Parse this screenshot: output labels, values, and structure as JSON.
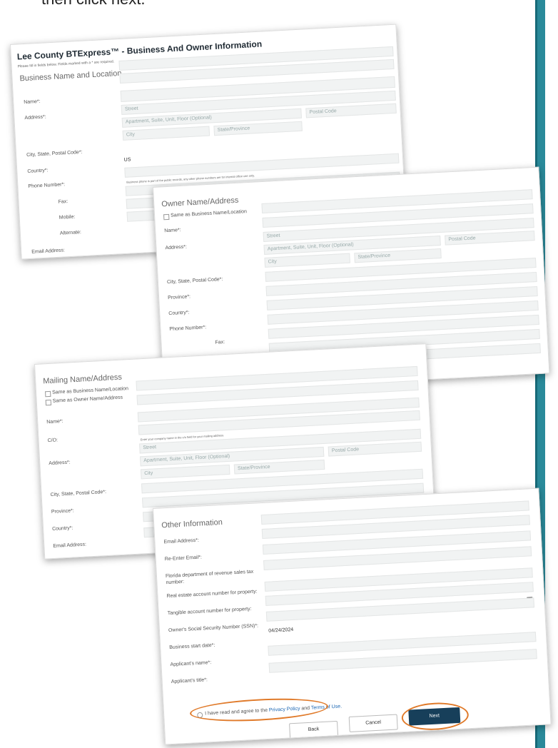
{
  "intro_text": "then click next.",
  "business": {
    "title": "Lee County BTExpress™ - Business And Owner Information",
    "required_note": "Please fill in fields below. Fields marked with a * are required.",
    "section_heading": "Business Name and Location",
    "labels": {
      "name": "Name*:",
      "address": "Address*:",
      "city_state_postal": "City, State, Postal Code*:",
      "country": "Country*:",
      "phone": "Phone Number*:",
      "fax": "Fax:",
      "mobile": "Mobile:",
      "alternate": "Alternate:",
      "email": "Email Address:"
    },
    "placeholders": {
      "street": "Street",
      "apartment": "Apartment, Suite, Unit, Floor (Optional)",
      "postal_code": "Postal Code",
      "city": "City",
      "state": "State/Province"
    },
    "country_value": "US",
    "phone_hint": "Business phone is part of the public records, any other phone numbers are for internal office use only."
  },
  "owner": {
    "section_heading": "Owner Name/Address",
    "same_as_business": "Same as Business Name/Location",
    "labels": {
      "name": "Name*:",
      "address": "Address*:",
      "city_state_postal": "City, State, Postal Code*:",
      "province": "Province*:",
      "country": "Country*:",
      "phone": "Phone Number*:",
      "fax": "Fax:"
    },
    "placeholders": {
      "street": "Street",
      "apartment": "Apartment, Suite, Unit, Floor (Optional)",
      "postal_code": "Postal Code",
      "city": "City",
      "state": "State/Province"
    }
  },
  "mailing": {
    "section_heading": "Mailing Name/Address",
    "same_as_business": "Same as Business Name/Location",
    "same_as_owner": "Same as Owner Name/Address",
    "labels": {
      "name": "Name*:",
      "co": "C/O:",
      "address": "Address*:",
      "city_state_postal": "City, State, Postal Code*:",
      "province": "Province*:",
      "country": "Country*:",
      "email": "Email Address:"
    },
    "co_hint": "Enter your company name in the c/o field for your mailing address.",
    "placeholders": {
      "street": "Street",
      "apartment": "Apartment, Suite, Unit, Floor (Optional)",
      "postal_code": "Postal Code",
      "city": "City",
      "state": "State/Province"
    }
  },
  "other": {
    "section_heading": "Other Information",
    "labels": {
      "email": "Email Address*:",
      "reenter_email": "Re-Enter Email*:",
      "sales_tax_1": "Florida department of revenue sales tax",
      "sales_tax_2": "number:",
      "real_estate": "Real estate account number for property:",
      "tangible": "Tangible account number for property:",
      "ssn": "Owner's Social Security Number (SSN)*:",
      "start_date": "Business start date*:",
      "applicant_name": "Applicant's name*:",
      "applicant_title": "Applicant's title*:"
    },
    "start_date_value": "04/24/2024",
    "agree_prefix": "I have read and agree to the",
    "privacy_policy": "Privacy Policy",
    "and": "and",
    "terms_of_use": "Terms of Use.",
    "buttons": {
      "back": "Back",
      "cancel": "Cancel",
      "next": "Next"
    }
  },
  "colors": {
    "highlight": "#e07a2a",
    "primary_button": "#173f5a",
    "side_bar": "#2a8a9a"
  }
}
